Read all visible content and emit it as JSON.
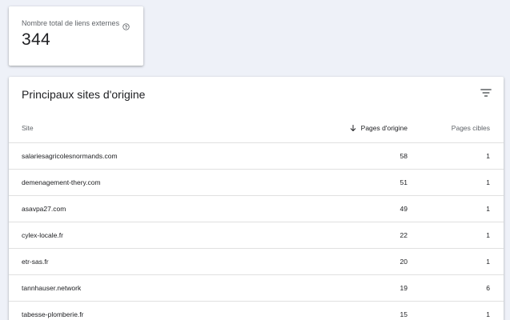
{
  "summary": {
    "label": "Nombre total de liens externes",
    "value": "344",
    "help_icon": "help-circle-icon"
  },
  "table": {
    "title": "Principaux sites d'origine",
    "filter_icon": "filter-icon",
    "headers": {
      "site": "Site",
      "pages_origine": "Pages d'origine",
      "pages_cibles": "Pages cibles"
    },
    "sort": {
      "column": "pages_origine",
      "direction": "descending",
      "icon": "arrow-down-icon"
    },
    "rows": [
      {
        "site": "salariesagricolesnormands.com",
        "pages_origine": "58",
        "pages_cibles": "1"
      },
      {
        "site": "demenagement-thery.com",
        "pages_origine": "51",
        "pages_cibles": "1"
      },
      {
        "site": "asavpa27.com",
        "pages_origine": "49",
        "pages_cibles": "1"
      },
      {
        "site": "cylex-locale.fr",
        "pages_origine": "22",
        "pages_cibles": "1"
      },
      {
        "site": "etr-sas.fr",
        "pages_origine": "20",
        "pages_cibles": "1"
      },
      {
        "site": "tannhauser.network",
        "pages_origine": "19",
        "pages_cibles": "6"
      },
      {
        "site": "tabesse-plomberie.fr",
        "pages_origine": "15",
        "pages_cibles": "1"
      }
    ]
  },
  "colors": {
    "background": "#eef1f8",
    "card": "#ffffff",
    "text_primary": "#202124",
    "text_secondary": "#5f6368",
    "divider": "#e0e0e0"
  }
}
